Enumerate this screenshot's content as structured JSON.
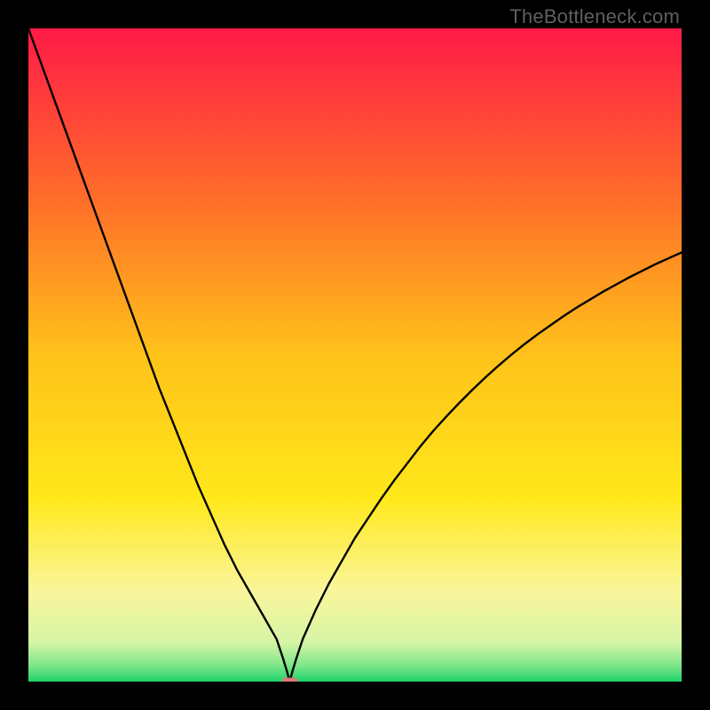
{
  "watermark": "TheBottleneck.com",
  "chart_data": {
    "type": "line",
    "title": "",
    "xlabel": "",
    "ylabel": "",
    "xlim": [
      0,
      100
    ],
    "ylim": [
      0,
      100
    ],
    "grid": false,
    "legend": false,
    "gradient_stops": [
      {
        "offset": 0.0,
        "color": "#ff1a47"
      },
      {
        "offset": 0.25,
        "color": "#ff6a2a"
      },
      {
        "offset": 0.5,
        "color": "#ffc21a"
      },
      {
        "offset": 0.72,
        "color": "#ffe81a"
      },
      {
        "offset": 0.86,
        "color": "#faf59a"
      },
      {
        "offset": 0.94,
        "color": "#d6f5a6"
      },
      {
        "offset": 0.975,
        "color": "#7fe68a"
      },
      {
        "offset": 1.0,
        "color": "#1fd36a"
      }
    ],
    "marker": {
      "x": 40.0,
      "y": 0.0,
      "color": "#d97a7a"
    },
    "series": [
      {
        "name": "curve",
        "color": "#000000",
        "x": [
          0,
          2,
          4,
          6,
          8,
          10,
          12,
          14,
          16,
          18,
          20,
          22,
          24,
          26,
          28,
          30,
          32,
          34,
          36,
          38,
          38.5,
          39,
          39.3,
          39.6,
          40,
          40.4,
          40.7,
          41,
          41.5,
          42,
          44,
          46,
          48,
          50,
          52,
          54,
          56,
          58,
          60,
          62,
          64,
          66,
          68,
          70,
          72,
          74,
          76,
          78,
          80,
          82,
          84,
          86,
          88,
          90,
          92,
          94,
          96,
          98,
          100
        ],
        "y": [
          100,
          94.5,
          89,
          83.5,
          78,
          72.5,
          67,
          61.5,
          56,
          50.5,
          45,
          40,
          35,
          30,
          25.5,
          21,
          17,
          13.5,
          10,
          6.5,
          5,
          3.5,
          2.5,
          1.5,
          0,
          1.5,
          2.5,
          3.5,
          5,
          6.5,
          11,
          15,
          18.5,
          22,
          25,
          28,
          30.8,
          33.4,
          36,
          38.4,
          40.6,
          42.7,
          44.7,
          46.6,
          48.4,
          50.1,
          51.7,
          53.2,
          54.6,
          56,
          57.3,
          58.5,
          59.7,
          60.8,
          61.9,
          62.9,
          63.9,
          64.8,
          65.7
        ]
      }
    ]
  }
}
